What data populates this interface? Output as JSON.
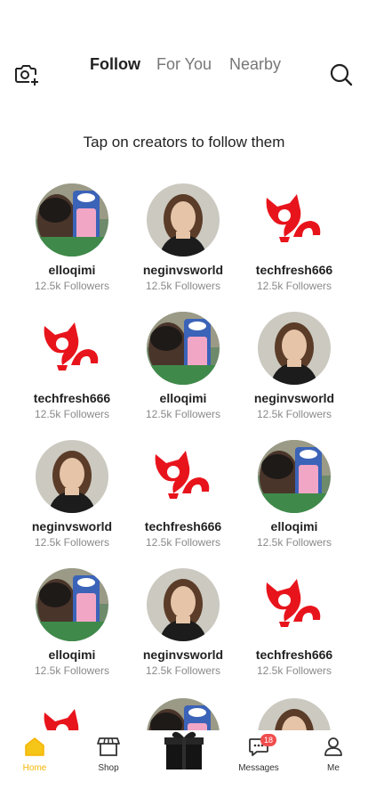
{
  "header": {
    "tabs": [
      {
        "label": "Follow",
        "active": true
      },
      {
        "label": "For You",
        "active": false
      },
      {
        "label": "Nearby",
        "active": false
      }
    ]
  },
  "main": {
    "headline": "Tap on creators to follow them",
    "creators": [
      {
        "name": "elloqimi",
        "followers": "12.5k Followers",
        "avatar": "photo-boy"
      },
      {
        "name": "neginvsworld",
        "followers": "12.5k Followers",
        "avatar": "photo-girl"
      },
      {
        "name": "techfresh666",
        "followers": "12.5k Followers",
        "avatar": "red-cat-logo"
      },
      {
        "name": "techfresh666",
        "followers": "12.5k Followers",
        "avatar": "red-cat-logo"
      },
      {
        "name": "elloqimi",
        "followers": "12.5k Followers",
        "avatar": "photo-boy"
      },
      {
        "name": "neginvsworld",
        "followers": "12.5k Followers",
        "avatar": "photo-girl"
      },
      {
        "name": "neginvsworld",
        "followers": "12.5k Followers",
        "avatar": "photo-girl"
      },
      {
        "name": "techfresh666",
        "followers": "12.5k Followers",
        "avatar": "red-cat-logo"
      },
      {
        "name": "elloqimi",
        "followers": "12.5k Followers",
        "avatar": "photo-boy"
      },
      {
        "name": "elloqimi",
        "followers": "12.5k Followers",
        "avatar": "photo-boy"
      },
      {
        "name": "neginvsworld",
        "followers": "12.5k Followers",
        "avatar": "photo-girl"
      },
      {
        "name": "techfresh666",
        "followers": "12.5k Followers",
        "avatar": "red-cat-logo"
      }
    ],
    "partial_row_avatars": [
      "red-cat-logo",
      "photo-boy",
      "photo-girl"
    ]
  },
  "bottom_nav": {
    "home_label": "Home",
    "shop_label": "Shop",
    "messages_label": "Messages",
    "messages_badge": "18",
    "me_label": "Me"
  },
  "colors": {
    "accent": "#f5b400",
    "logo_red": "#e8141c",
    "badge": "#f04d4d"
  }
}
